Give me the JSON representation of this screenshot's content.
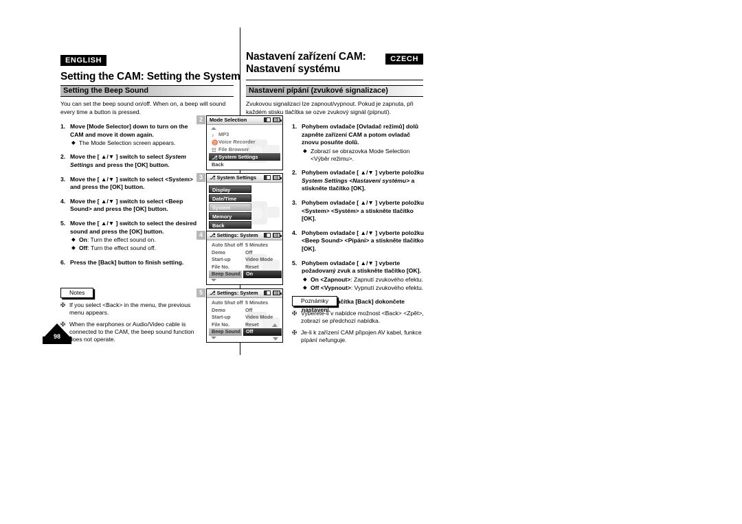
{
  "page": {
    "number": "98"
  },
  "left": {
    "lang_badge": "ENGLISH",
    "title": "Setting the CAM: Setting the System",
    "section": "Setting the Beep Sound",
    "intro": "You can set the beep sound on/off. When on, a beep will sound every time a button is pressed.",
    "steps": [
      {
        "num": "1.",
        "text": "Move [Mode Selector] down to turn on the CAM and move it down again.",
        "subs": [
          {
            "bullet": "◆",
            "text": "The Mode Selection screen appears."
          }
        ]
      },
      {
        "num": "2.",
        "text_pre": "Move the [ ▲/▼ ] switch to select ",
        "text_em": "System Settings",
        "text_post": " and press the [OK] button.",
        "subs": []
      },
      {
        "num": "3.",
        "text": "Move the [ ▲/▼ ] switch to select <System> and press the [OK] button.",
        "subs": []
      },
      {
        "num": "4.",
        "text": "Move the [ ▲/▼ ] switch to select <Beep Sound> and press the [OK] button.",
        "subs": []
      },
      {
        "num": "5.",
        "text": "Move the [ ▲/▼ ] switch to select the desired sound and press the [OK] button.",
        "subs": [
          {
            "bullet": "◆",
            "bold": "On",
            "text": ": Turn the effect sound on."
          },
          {
            "bullet": "◆",
            "bold": "Off",
            "text": ": Turn the effect sound off."
          }
        ]
      },
      {
        "num": "6.",
        "text": "Press the [Back] button to finish setting.",
        "subs": []
      }
    ],
    "notes_label": "Notes",
    "notes": [
      {
        "bullet": "✠",
        "text": "If you select <Back> in the menu, the previous menu appears."
      },
      {
        "bullet": "✠",
        "text": "When the earphones or Audio/Video cable is connected to the CAM, the beep sound function does not operate."
      }
    ]
  },
  "right": {
    "lang_badge": "CZECH",
    "title_line1": "Nastavení zařízení CAM:",
    "title_line2": "Nastavení systému",
    "section": "Nastavení pípání (zvukové signalizace)",
    "intro": "Zvukovou signalizaci lze zapnout/vypnout. Pokud je zapnuta, při každém stisku tlačítka se ozve zvukový signál (pípnutí).",
    "steps": [
      {
        "num": "1.",
        "text": "Pohybem ovladače [Ovladač režimů] dolů zapněte zařízení CAM a potom ovladač znovu posuňte dolů.",
        "subs": [
          {
            "bullet": "◆",
            "text": "Zobrazí se obrazovka Mode Selection <Výběr režimu>."
          }
        ]
      },
      {
        "num": "2.",
        "text_pre": "Pohybem ovladače [ ▲/▼ ] vyberte položku ",
        "text_em": "System Settings <Nastavení systému>",
        "text_post": " a stiskněte tlačítko [OK].",
        "subs": []
      },
      {
        "num": "3.",
        "text": "Pohybem ovladače [ ▲/▼ ] vyberte položku <System> <Systém> a stiskněte tlačítko [OK].",
        "subs": []
      },
      {
        "num": "4.",
        "text": "Pohybem ovladače [ ▲/▼ ] vyberte položku <Beep Sound> <Pípání> a stiskněte tlačítko [OK].",
        "subs": []
      },
      {
        "num": "5.",
        "text": "Pohybem ovladače [ ▲/▼ ] vyberte požadovaný zvuk a stiskněte tlačítko [OK].",
        "subs": [
          {
            "bullet": "◆",
            "bold": "On <Zapnout>",
            "text": ": Zapnutí zvukového efektu."
          },
          {
            "bullet": "◆",
            "bold": "Off <Vypnout>",
            "text": ": Vypnutí zvukového efektu."
          }
        ]
      },
      {
        "num": "6.",
        "text": "Stisknutím tlačítka [Back] dokončete nastavení.",
        "subs": []
      }
    ],
    "notes_label": "Poznámky",
    "notes": [
      {
        "bullet": "✠",
        "text": "Vyberete-li v nabídce možnost <Back> <Zpět>, zobrazí se předchozí nabídka."
      },
      {
        "bullet": "✠",
        "text": "Je-li k zařízení CAM připojen AV kabel, funkce pípání nefunguje."
      }
    ]
  },
  "lcd_screens": [
    {
      "step": "2",
      "kind": "mode-selection",
      "title": "Mode Selection",
      "title_icon": "",
      "has_up_arrow": true,
      "rows": [
        {
          "icon": "♪",
          "label": "MP3",
          "selected": false
        },
        {
          "icon": "♉",
          "label": "Voice Recorder",
          "selected": false
        },
        {
          "icon": "☷",
          "label": "File Browser",
          "selected": false
        },
        {
          "icon": "⎇",
          "label": "System Settings",
          "selected": true
        },
        {
          "icon": "",
          "label": "Back",
          "selected": false,
          "plain": true
        }
      ]
    },
    {
      "step": "3",
      "kind": "button-list",
      "title": "System Settings",
      "title_icon": "⎇",
      "rows": [
        {
          "label": "Display",
          "selected": false
        },
        {
          "label": "Date/Time",
          "selected": false
        },
        {
          "label": "System",
          "selected": true
        },
        {
          "label": "Memory",
          "selected": false
        },
        {
          "label": "Back",
          "selected": false
        }
      ]
    },
    {
      "step": "4",
      "kind": "settings-table",
      "title": "Settings: System",
      "title_icon": "⎇",
      "rows": [
        {
          "label": "Auto Shut off",
          "value": "5 Minutes",
          "selected": false
        },
        {
          "label": "Demo",
          "value": "Off",
          "selected": false
        },
        {
          "label": "Start-up",
          "value": "Video Mode",
          "selected": false
        },
        {
          "label": "File No.",
          "value": "Reset",
          "selected": false
        },
        {
          "label": "Beep Sound",
          "value": "On",
          "selected": true
        }
      ],
      "scroll_down": true,
      "value_scroll_up": false,
      "value_scroll_down": false
    },
    {
      "step": "5",
      "kind": "settings-table",
      "title": "Settings: System",
      "title_icon": "⎇",
      "rows": [
        {
          "label": "Auto Shut off",
          "value": "5 Minutes",
          "selected": false
        },
        {
          "label": "Demo",
          "value": "Off",
          "selected": false
        },
        {
          "label": "Start-up",
          "value": "Video Mode",
          "selected": false
        },
        {
          "label": "File No.",
          "value": "Reset",
          "selected": false
        },
        {
          "label": "Beep Sound",
          "value": "Off",
          "selected": true
        }
      ],
      "scroll_down": true,
      "value_scroll_up": true,
      "value_scroll_down": true
    }
  ]
}
